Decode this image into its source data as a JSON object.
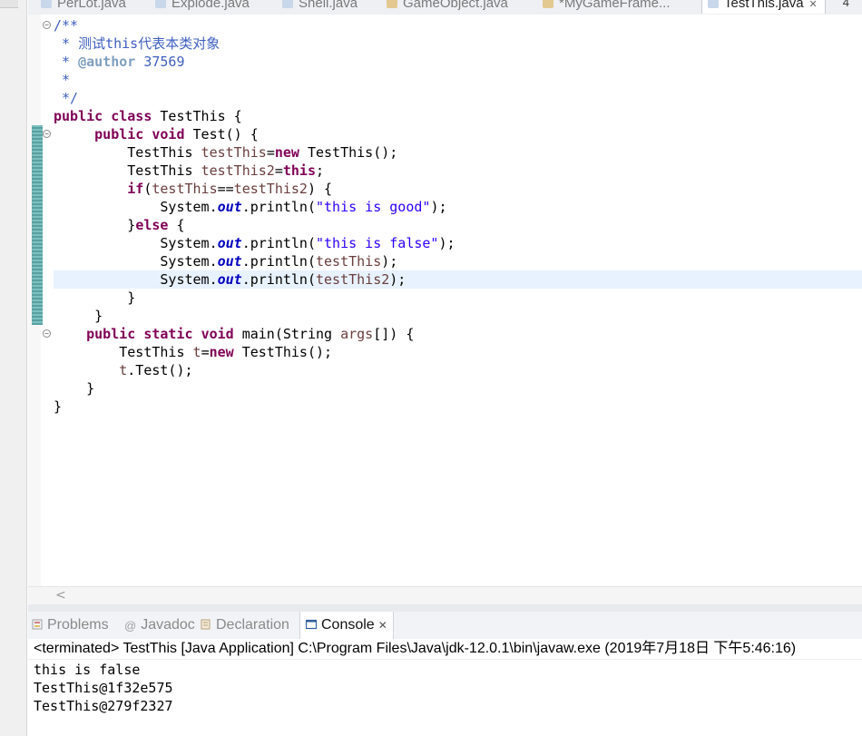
{
  "tabs": [
    {
      "label": "PerLot.java",
      "active": false
    },
    {
      "label": "Explode.java",
      "active": false
    },
    {
      "label": "Shell.java",
      "active": false
    },
    {
      "label": "GameObject.java",
      "active": false
    },
    {
      "label": "*MyGameFrame...",
      "active": false
    },
    {
      "label": "TestThis.java",
      "active": true
    }
  ],
  "tab_overflow_count": "4",
  "tab_close_glyph": "✕",
  "colors": {
    "keyword": "#7f0055",
    "comment": "#3f5fbf",
    "string": "#2a00ff",
    "local_var": "#6a3e3e",
    "static_field": "#0000c0",
    "current_line": "#e8f2fe"
  },
  "editor": {
    "lines": [
      [
        {
          "t": "comment",
          "v": "/**"
        }
      ],
      [
        {
          "t": "comment",
          "v": " * 测试this代表本类对象"
        }
      ],
      [
        {
          "t": "comment",
          "v": " * "
        },
        {
          "t": "tag",
          "v": "@author"
        },
        {
          "t": "comment",
          "v": " 37569"
        }
      ],
      [
        {
          "t": "comment",
          "v": " *"
        }
      ],
      [
        {
          "t": "comment",
          "v": " */"
        }
      ],
      [
        {
          "t": "kw",
          "v": "public"
        },
        {
          "t": "plain",
          "v": " "
        },
        {
          "t": "kw",
          "v": "class"
        },
        {
          "t": "plain",
          "v": " TestThis {"
        }
      ],
      [
        {
          "t": "plain",
          "v": "     "
        },
        {
          "t": "kw",
          "v": "public"
        },
        {
          "t": "plain",
          "v": " "
        },
        {
          "t": "kw",
          "v": "void"
        },
        {
          "t": "plain",
          "v": " Test() {"
        }
      ],
      [
        {
          "t": "plain",
          "v": "         TestThis "
        },
        {
          "t": "var",
          "v": "testThis"
        },
        {
          "t": "plain",
          "v": "="
        },
        {
          "t": "kw",
          "v": "new"
        },
        {
          "t": "plain",
          "v": " TestThis();"
        }
      ],
      [
        {
          "t": "plain",
          "v": "         TestThis "
        },
        {
          "t": "var",
          "v": "testThis2"
        },
        {
          "t": "plain",
          "v": "="
        },
        {
          "t": "kw",
          "v": "this"
        },
        {
          "t": "plain",
          "v": ";"
        }
      ],
      [
        {
          "t": "plain",
          "v": "         "
        },
        {
          "t": "kw",
          "v": "if"
        },
        {
          "t": "plain",
          "v": "("
        },
        {
          "t": "var",
          "v": "testThis"
        },
        {
          "t": "plain",
          "v": "=="
        },
        {
          "t": "var",
          "v": "testThis2"
        },
        {
          "t": "plain",
          "v": ") {"
        }
      ],
      [
        {
          "t": "plain",
          "v": "             System."
        },
        {
          "t": "static",
          "v": "out"
        },
        {
          "t": "plain",
          "v": ".println("
        },
        {
          "t": "str",
          "v": "\"this is good\""
        },
        {
          "t": "plain",
          "v": ");"
        }
      ],
      [
        {
          "t": "plain",
          "v": "         }"
        },
        {
          "t": "kw",
          "v": "else"
        },
        {
          "t": "plain",
          "v": " {"
        }
      ],
      [
        {
          "t": "plain",
          "v": "             System."
        },
        {
          "t": "static",
          "v": "out"
        },
        {
          "t": "plain",
          "v": ".println("
        },
        {
          "t": "str",
          "v": "\"this is false\""
        },
        {
          "t": "plain",
          "v": ");"
        }
      ],
      [
        {
          "t": "plain",
          "v": "             System."
        },
        {
          "t": "static",
          "v": "out"
        },
        {
          "t": "plain",
          "v": ".println("
        },
        {
          "t": "var",
          "v": "testThis"
        },
        {
          "t": "plain",
          "v": ");"
        }
      ],
      [
        {
          "t": "plain",
          "v": "             System."
        },
        {
          "t": "static",
          "v": "out"
        },
        {
          "t": "plain",
          "v": ".println("
        },
        {
          "t": "var",
          "v": "testThis2"
        },
        {
          "t": "plain",
          "v": ");"
        }
      ],
      [
        {
          "t": "plain",
          "v": "         }"
        }
      ],
      [
        {
          "t": "plain",
          "v": "     }"
        }
      ],
      [
        {
          "t": "plain",
          "v": "    "
        },
        {
          "t": "kw",
          "v": "public"
        },
        {
          "t": "plain",
          "v": " "
        },
        {
          "t": "kw",
          "v": "static"
        },
        {
          "t": "plain",
          "v": " "
        },
        {
          "t": "kw",
          "v": "void"
        },
        {
          "t": "plain",
          "v": " main(String "
        },
        {
          "t": "var",
          "v": "args"
        },
        {
          "t": "plain",
          "v": "[]) {"
        }
      ],
      [
        {
          "t": "plain",
          "v": "        TestThis "
        },
        {
          "t": "var",
          "v": "t"
        },
        {
          "t": "plain",
          "v": "="
        },
        {
          "t": "kw",
          "v": "new"
        },
        {
          "t": "plain",
          "v": " TestThis();"
        }
      ],
      [
        {
          "t": "plain",
          "v": "        "
        },
        {
          "t": "var",
          "v": "t"
        },
        {
          "t": "plain",
          "v": ".Test();"
        }
      ],
      [
        {
          "t": "plain",
          "v": "    }"
        }
      ],
      [
        {
          "t": "plain",
          "v": "}"
        }
      ]
    ],
    "current_line": 14,
    "fold_markers": [
      0,
      6,
      17
    ],
    "fold_glyph": "⊖",
    "scroll_left_glyph": "<"
  },
  "views": {
    "tabs": [
      {
        "label": "Problems",
        "icon": "problems-icon",
        "active": false
      },
      {
        "label": "Javadoc",
        "icon": "javadoc-icon",
        "active": false
      },
      {
        "label": "Declaration",
        "icon": "declaration-icon",
        "active": false
      },
      {
        "label": "Console",
        "icon": "console-icon",
        "active": true
      }
    ]
  },
  "console": {
    "header": "<terminated> TestThis [Java Application] C:\\Program Files\\Java\\jdk-12.0.1\\bin\\javaw.exe (2019年7月18日 下午5:46:16)",
    "output": [
      "this is false",
      "TestThis@1f32e575",
      "TestThis@279f2327"
    ]
  }
}
